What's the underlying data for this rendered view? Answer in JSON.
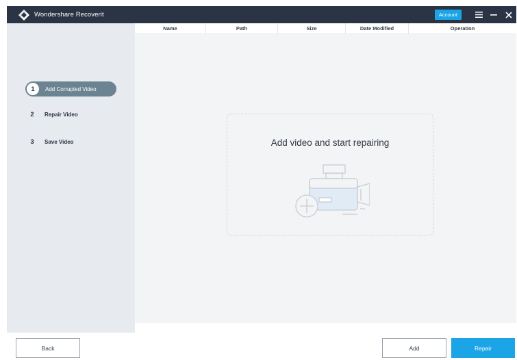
{
  "app": {
    "title": "Wondershare Recoverit"
  },
  "titlebar": {
    "account_label": "Account",
    "icons": [
      "menu-icon",
      "minimize-icon",
      "close-icon"
    ]
  },
  "steps": [
    {
      "number": "1",
      "label": "Add Corrupted Video",
      "active": true
    },
    {
      "number": "2",
      "label": "Repair Video",
      "active": false
    },
    {
      "number": "3",
      "label": "Save Video",
      "active": false
    }
  ],
  "table": {
    "columns": [
      "Name",
      "Path",
      "Size",
      "Date Modified",
      "Operation"
    ]
  },
  "dropzone": {
    "text": "Add video and start repairing",
    "icon": "add-video-icon"
  },
  "footer": {
    "back_label": "Back",
    "add_label": "Add",
    "repair_label": "Repair"
  },
  "colors": {
    "titlebar": "#2b3444",
    "accent": "#1ba4e6",
    "active_step": "#6c8492",
    "sidebar": "#e7eaee",
    "main_bg": "#f3f4f6"
  }
}
